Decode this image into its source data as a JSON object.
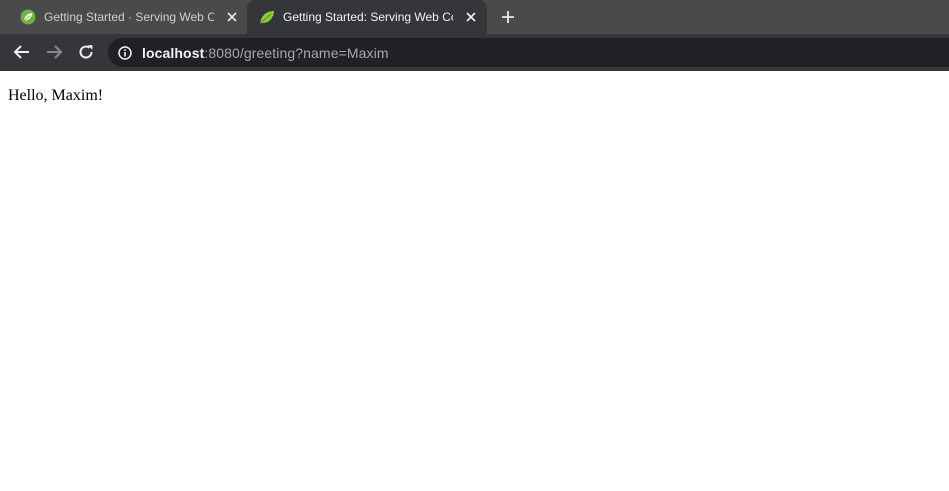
{
  "tabs": [
    {
      "title": "Getting Started · Serving Web Co",
      "active": false
    },
    {
      "title": "Getting Started: Serving Web Co",
      "active": true
    }
  ],
  "toolbar": {
    "url_host": "localhost",
    "url_rest": ":8080/greeting?name=Maxim"
  },
  "page": {
    "greeting": "Hello, Maxim!"
  },
  "colors": {
    "tabstrip": "#4b4a4a",
    "toolbar": "#35363a",
    "omnibox": "#202124",
    "spring_green": "#6db33f"
  }
}
